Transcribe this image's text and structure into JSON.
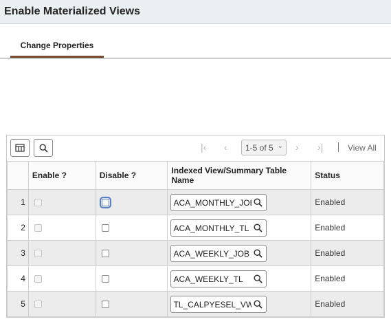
{
  "page": {
    "title": "Enable Materialized Views"
  },
  "tabs": [
    {
      "label": "Change Properties"
    }
  ],
  "toolbar": {
    "pager_text": "1-5 of 5",
    "view_all": "View All"
  },
  "table": {
    "headers": {
      "rownum": "",
      "enable": "Enable ?",
      "disable": "Disable ?",
      "view_name": "Indexed View/Summary Table Name",
      "status": "Status"
    },
    "rows": [
      {
        "num": "1",
        "view_name": "ACA_MONTHLY_JOB",
        "status": "Enabled"
      },
      {
        "num": "2",
        "view_name": "ACA_MONTHLY_TL",
        "status": "Enabled"
      },
      {
        "num": "3",
        "view_name": "ACA_WEEKLY_JOB",
        "status": "Enabled"
      },
      {
        "num": "4",
        "view_name": "ACA_WEEKLY_TL",
        "status": "Enabled"
      },
      {
        "num": "5",
        "view_name": "TL_CALPYESEL_VW",
        "status": "Enabled"
      }
    ]
  },
  "colors": {
    "title_bg": "#eaf0f1",
    "tab_underline": "#7a4a32",
    "row_alt_bg": "#ececec"
  }
}
